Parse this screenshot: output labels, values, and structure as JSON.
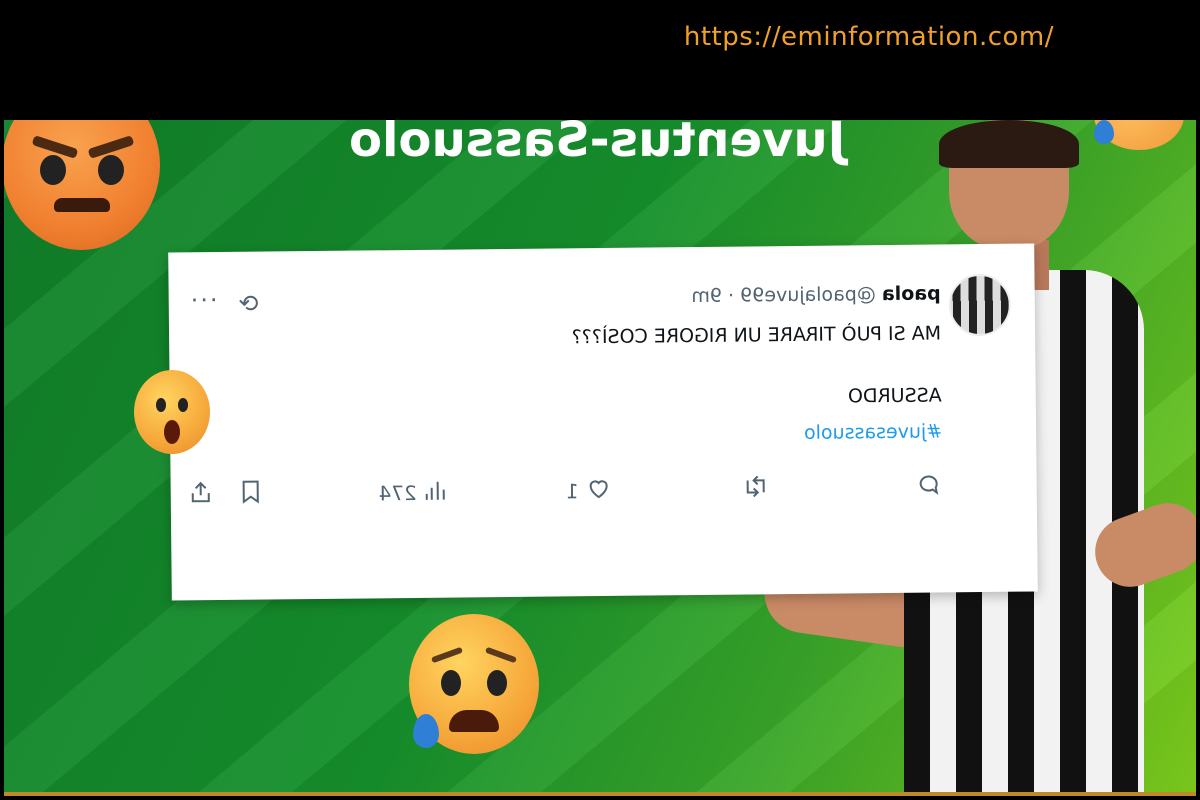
{
  "header": {
    "url": "https://eminformation.com/"
  },
  "headline": "Juventus-Sassuolo",
  "tweet": {
    "name": "paola",
    "handle": "@paolajuve99",
    "separator": "·",
    "time": "9m",
    "line1": "MA SI PUÒ TIRARE UN RIGORE COSÌ???",
    "line2": "ASSURDO",
    "hashtag": "#juvesassuolo",
    "replies": "",
    "retweets": "",
    "likes": "1",
    "views": "274",
    "icons": {
      "reply": "reply-icon",
      "retweet": "retweet-icon",
      "like": "heart-icon",
      "views": "views-icon",
      "bookmark": "bookmark-icon",
      "share": "share-icon",
      "grok": "grok-icon",
      "more": "more-icon"
    }
  },
  "colors": {
    "url": "#f0a02a",
    "hashtag": "#1d9bf0",
    "background": "#16912c"
  }
}
